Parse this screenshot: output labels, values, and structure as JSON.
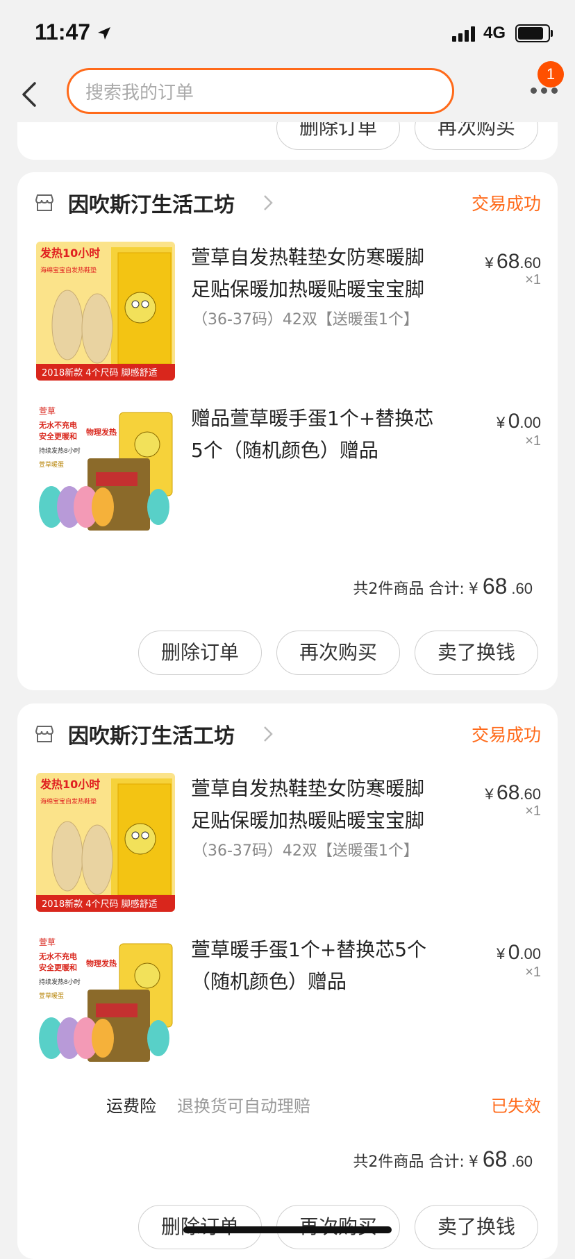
{
  "status_bar": {
    "time": "11:47",
    "network": "4G"
  },
  "nav": {
    "search_placeholder": "搜索我的订单",
    "badge_count": "1"
  },
  "previous_card": {
    "buttons": [
      "删除订单",
      "再次购买"
    ]
  },
  "orders": [
    {
      "shop_name": "因吹斯汀生活工坊",
      "status": "交易成功",
      "items": [
        {
          "title_line1": "萱草自发热鞋垫女防寒暖脚",
          "title_line2": "足贴保暖加热暖贴暖宝宝脚",
          "spec": "（36-37码）42双【送暖蛋1个】",
          "price_symbol": "¥",
          "price_int": "68",
          "price_dec": ".60",
          "qty": "×1"
        },
        {
          "title_line1": "赠品萱草暖手蛋1个+替换芯",
          "title_line2": "5个（随机颜色）赠品",
          "price_symbol": "¥",
          "price_int": "0",
          "price_dec": ".00",
          "qty": "×1"
        }
      ],
      "summary_label": "共2件商品 合计:",
      "total_symbol": "¥",
      "total_int": "68",
      "total_dec": ".60",
      "buttons": [
        "删除订单",
        "再次购买",
        "卖了换钱"
      ]
    },
    {
      "shop_name": "因吹斯汀生活工坊",
      "status": "交易成功",
      "items": [
        {
          "title_line1": "萱草自发热鞋垫女防寒暖脚",
          "title_line2": "足贴保暖加热暖贴暖宝宝脚",
          "spec": "（36-37码）42双【送暖蛋1个】",
          "price_symbol": "¥",
          "price_int": "68",
          "price_dec": ".60",
          "qty": "×1"
        },
        {
          "title_line1": "萱草暖手蛋1个+替换芯5个",
          "title_line2": "（随机颜色）赠品",
          "price_symbol": "¥",
          "price_int": "0",
          "price_dec": ".00",
          "qty": "×1"
        }
      ],
      "insurance": {
        "label": "运费险",
        "desc": "退换货可自动理赔",
        "status": "已失效"
      },
      "summary_label": "共2件商品 合计:",
      "total_symbol": "¥",
      "total_int": "68",
      "total_dec": ".60",
      "buttons": [
        "删除订单",
        "再次购买",
        "卖了换钱"
      ]
    }
  ],
  "thumb_texts": {
    "insole_banner": "发热10小时",
    "insole_sub": "海绵宝宝自发热鞋垫",
    "insole_footer": "2018新款 4个尺码 脚感舒适",
    "egg_brand": "萱草",
    "egg_tag1": "无水不充电",
    "egg_tag2": "安全更暖和",
    "egg_tag3": "物理发热",
    "egg_tag4": "持续发热8小时",
    "egg_pack": "萱草暖蛋"
  },
  "colors": {
    "accent": "#ff6a1a",
    "badge": "#ff5000",
    "background": "#f2f2f2"
  }
}
